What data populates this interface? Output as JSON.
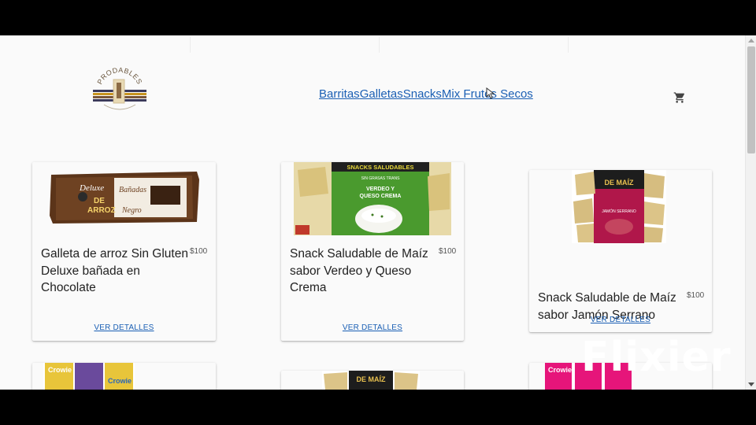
{
  "header": {
    "logo_text": "PRODABLES",
    "nav": [
      "Barritas",
      "Galletas",
      "Snacks",
      "Mix Frutos Secos"
    ]
  },
  "products": [
    {
      "name": "Galleta de arroz Sin Gluten Deluxe bañada en Chocolate",
      "price": "$100",
      "details_label": "VER DETALLES",
      "image_text": [
        "Deluxe",
        "DE",
        "ARROZ",
        "Bañadas",
        "Negro"
      ]
    },
    {
      "name": "Snack Saludable de Maíz sabor Verdeo y Queso Crema",
      "price": "$100",
      "details_label": "VER DETALLES",
      "image_text": [
        "SNACKS SALUDABLES",
        "SIN GRASAS TRANS",
        "VERDEO Y",
        "QUESO CREMA"
      ]
    },
    {
      "name": "Snack Saludable de Maíz sabor Jamón Serrano",
      "price": "$100",
      "details_label": "VER DETALLES",
      "image_text": [
        "DE MAÍZ",
        "JAMÓN SERRANO"
      ]
    }
  ],
  "partial_products": [
    {
      "image_text": [
        "Crowie",
        "Crowie"
      ]
    },
    {
      "image_text": [
        "DE MAÍZ"
      ]
    },
    {
      "image_text": [
        "Crowie"
      ]
    }
  ],
  "watermark": "Flixier",
  "colors": {
    "link": "#1a5fb4",
    "background": "#fafafa"
  }
}
